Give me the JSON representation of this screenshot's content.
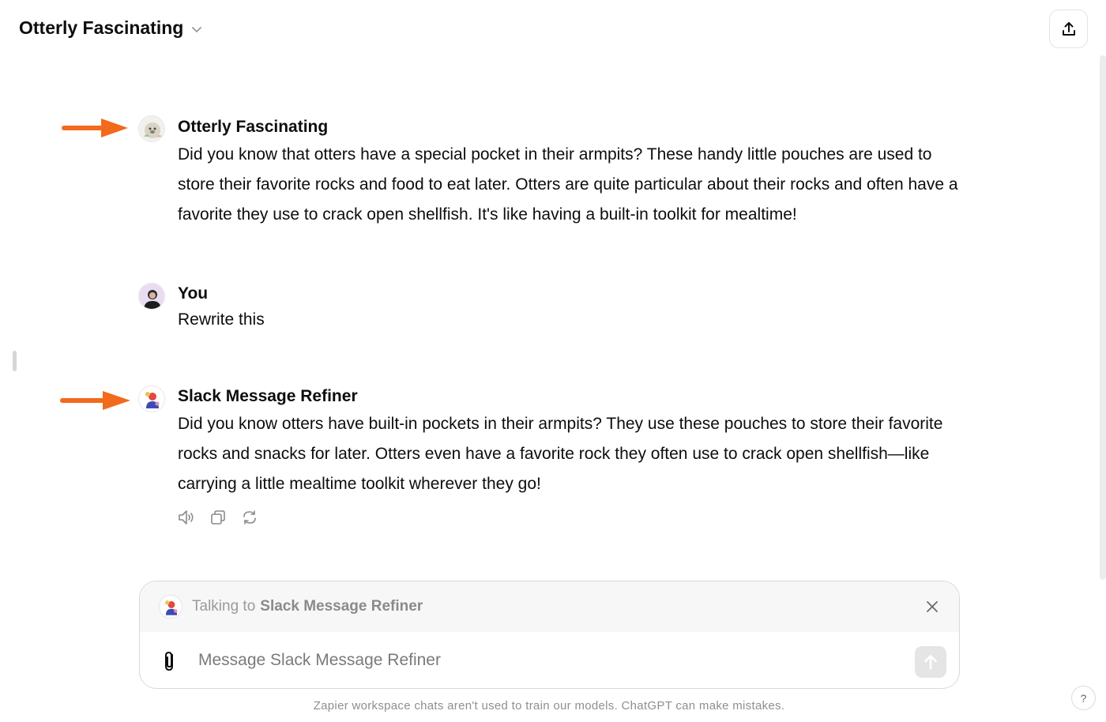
{
  "header": {
    "title": "Otterly Fascinating",
    "chevron_icon": "chevron-down-icon",
    "share_icon": "share-upload-icon"
  },
  "messages": [
    {
      "author": "Otterly Fascinating",
      "avatar": "otter-gpt-avatar",
      "text": "Did you know that otters have a special pocket in their armpits? These handy little pouches are used to store their favorite rocks and food to eat later. Otters are quite particular about their rocks and often have a favorite they use to crack open shellfish. It's like having a built-in toolkit for mealtime!"
    },
    {
      "author": "You",
      "avatar": "user-avatar",
      "text": "Rewrite this"
    },
    {
      "author": "Slack Message Refiner",
      "avatar": "slack-refiner-gpt-avatar",
      "text": "Did you know otters have built-in pockets in their armpits? They use these pouches to store their favorite rocks and snacks for later. Otters even have a favorite rock they often use to crack open shellfish—like carrying a little mealtime toolkit wherever they go!"
    }
  ],
  "message_actions": [
    "read-aloud-icon",
    "copy-icon",
    "regenerate-icon"
  ],
  "composer": {
    "talking_prefix": "Talking to",
    "talking_name": "Slack Message Refiner",
    "placeholder": "Message Slack Message Refiner"
  },
  "footer": {
    "disclaimer": "Zapier workspace chats aren't used to train our models. ChatGPT can make mistakes.",
    "help_label": "?"
  },
  "colors": {
    "annotation_arrow": "#f26a1b",
    "text_primary": "#0d0d0d",
    "muted": "#8f8f8f"
  }
}
